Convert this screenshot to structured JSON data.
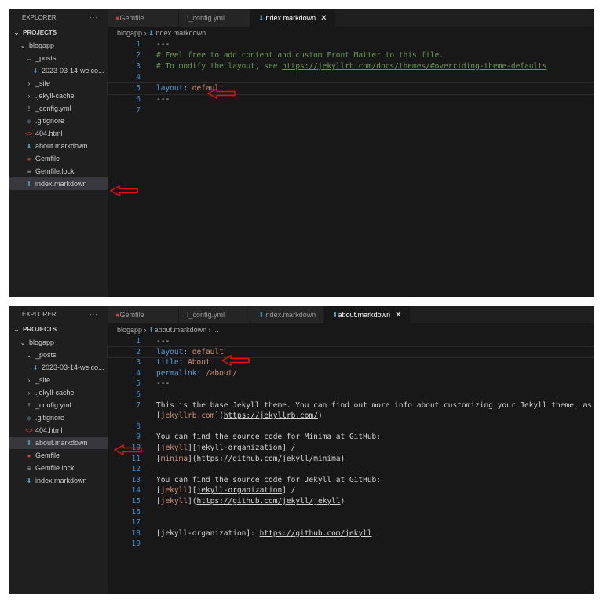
{
  "accent": "#569cd6",
  "arrow_color": "#e01010",
  "panels": [
    {
      "explorer_title": "EXPLORER",
      "more": "···",
      "projects": "PROJECTS",
      "tree": [
        {
          "label": "blogapp",
          "icon": "chevron-down",
          "indent": 1
        },
        {
          "label": "_posts",
          "icon": "chevron-down",
          "indent": 2
        },
        {
          "label": "2023-03-14-welco...",
          "icon": "markdown",
          "indent": 3
        },
        {
          "label": "_site",
          "icon": "chevron-right",
          "indent": 2
        },
        {
          "label": ".jekyll-cache",
          "icon": "chevron-right",
          "indent": 2
        },
        {
          "label": "_config.yml",
          "icon": "yaml",
          "indent": 2
        },
        {
          "label": ".gitignore",
          "icon": "git",
          "indent": 2
        },
        {
          "label": "404.html",
          "icon": "html",
          "indent": 2
        },
        {
          "label": "about.markdown",
          "icon": "markdown",
          "indent": 2
        },
        {
          "label": "Gemfile",
          "icon": "ruby",
          "indent": 2
        },
        {
          "label": "Gemfile.lock",
          "icon": "lock-file",
          "indent": 2
        },
        {
          "label": "index.markdown",
          "icon": "markdown",
          "indent": 2,
          "selected": true
        }
      ],
      "tabs": [
        {
          "label": "Gemfile",
          "icon": "ruby"
        },
        {
          "label": "_config.yml",
          "icon": "yaml"
        },
        {
          "label": "index.markdown",
          "icon": "markdown",
          "active": true
        }
      ],
      "breadcrumb": [
        "blogapp",
        "index.markdown"
      ],
      "lines": [
        {
          "n": "1",
          "t": [
            [
              "t",
              "---"
            ]
          ]
        },
        {
          "n": "2",
          "t": [
            [
              "c",
              "# Feel free to add content and custom Front Matter to this file."
            ]
          ]
        },
        {
          "n": "3",
          "t": [
            [
              "c",
              "# To modify the layout, see "
            ],
            [
              "c u",
              "https://jekyllrb.com/docs/themes/#overriding-theme-defaults"
            ]
          ]
        },
        {
          "n": "4",
          "t": []
        },
        {
          "n": "5",
          "t": [
            [
              "k",
              "layout"
            ],
            [
              "t",
              ": "
            ],
            [
              "s",
              "default"
            ]
          ],
          "cur": true
        },
        {
          "n": "6",
          "t": [
            [
              "t",
              "---"
            ]
          ]
        },
        {
          "n": "7",
          "t": []
        }
      ]
    },
    {
      "explorer_title": "EXPLORER",
      "more": "···",
      "projects": "PROJECTS",
      "tree": [
        {
          "label": "blogapp",
          "icon": "chevron-down",
          "indent": 1
        },
        {
          "label": "_posts",
          "icon": "chevron-down",
          "indent": 2
        },
        {
          "label": "2023-03-14-welco...",
          "icon": "markdown",
          "indent": 3
        },
        {
          "label": "_site",
          "icon": "chevron-right",
          "indent": 2
        },
        {
          "label": ".jekyll-cache",
          "icon": "chevron-right",
          "indent": 2
        },
        {
          "label": "_config.yml",
          "icon": "yaml",
          "indent": 2
        },
        {
          "label": ".gitignore",
          "icon": "git",
          "indent": 2
        },
        {
          "label": "404.html",
          "icon": "html",
          "indent": 2
        },
        {
          "label": "about.markdown",
          "icon": "markdown",
          "indent": 2,
          "selected": true
        },
        {
          "label": "Gemfile",
          "icon": "ruby",
          "indent": 2
        },
        {
          "label": "Gemfile.lock",
          "icon": "lock-file",
          "indent": 2
        },
        {
          "label": "index.markdown",
          "icon": "markdown",
          "indent": 2
        }
      ],
      "tabs": [
        {
          "label": "Gemfile",
          "icon": "ruby"
        },
        {
          "label": "_config.yml",
          "icon": "yaml"
        },
        {
          "label": "index.markdown",
          "icon": "markdown"
        },
        {
          "label": "about.markdown",
          "icon": "markdown",
          "active": true
        }
      ],
      "breadcrumb": [
        "blogapp",
        "about.markdown",
        "..."
      ],
      "lines": [
        {
          "n": "1",
          "t": [
            [
              "t",
              "---"
            ]
          ]
        },
        {
          "n": "2",
          "t": [
            [
              "k",
              "layout"
            ],
            [
              "t",
              ": "
            ],
            [
              "s",
              "default"
            ]
          ],
          "cur": true
        },
        {
          "n": "3",
          "t": [
            [
              "k",
              "title"
            ],
            [
              "t",
              ": "
            ],
            [
              "s",
              "About"
            ]
          ]
        },
        {
          "n": "4",
          "t": [
            [
              "k",
              "permalink"
            ],
            [
              "t",
              ": "
            ],
            [
              "s",
              "/about/"
            ]
          ]
        },
        {
          "n": "5",
          "t": [
            [
              "t",
              "---"
            ]
          ]
        },
        {
          "n": "6",
          "t": []
        },
        {
          "n": "7",
          "t": [
            [
              "t",
              "This is the base Jekyll theme. You can find out more info about customizing your Jekyll theme, as well as"
            ]
          ]
        },
        {
          "n": "",
          "t": [
            [
              "t",
              "["
            ],
            [
              "s",
              "jekyllrb.com"
            ],
            [
              "t",
              "]("
            ],
            [
              "t u",
              "https://jekyllrb.com/"
            ],
            [
              "t",
              ")"
            ]
          ]
        },
        {
          "n": "8",
          "t": []
        },
        {
          "n": "9",
          "t": [
            [
              "t",
              "You can find the source code for Minima at GitHub:"
            ]
          ]
        },
        {
          "n": "10",
          "t": [
            [
              "t",
              "["
            ],
            [
              "s",
              "jekyll"
            ],
            [
              "t",
              "]["
            ],
            [
              "t u",
              "jekyll-organization"
            ],
            [
              "t",
              "] /"
            ]
          ]
        },
        {
          "n": "11",
          "t": [
            [
              "t",
              "["
            ],
            [
              "s",
              "minima"
            ],
            [
              "t",
              "]("
            ],
            [
              "t u",
              "https://github.com/jekyll/minima"
            ],
            [
              "t",
              ")"
            ]
          ]
        },
        {
          "n": "12",
          "t": []
        },
        {
          "n": "13",
          "t": [
            [
              "t",
              "You can find the source code for Jekyll at GitHub:"
            ]
          ]
        },
        {
          "n": "14",
          "t": [
            [
              "t",
              "["
            ],
            [
              "s",
              "jekyll"
            ],
            [
              "t",
              "]["
            ],
            [
              "t u",
              "jekyll-organization"
            ],
            [
              "t",
              "] /"
            ]
          ]
        },
        {
          "n": "15",
          "t": [
            [
              "t",
              "["
            ],
            [
              "s",
              "jekyll"
            ],
            [
              "t",
              "]("
            ],
            [
              "t u",
              "https://github.com/jekyll/jekyll"
            ],
            [
              "t",
              ")"
            ]
          ]
        },
        {
          "n": "16",
          "t": []
        },
        {
          "n": "17",
          "t": []
        },
        {
          "n": "18",
          "t": [
            [
              "t",
              "[jekyll-organization]: "
            ],
            [
              "t u",
              "https://github.com/jekyll"
            ]
          ]
        },
        {
          "n": "19",
          "t": []
        }
      ]
    }
  ]
}
